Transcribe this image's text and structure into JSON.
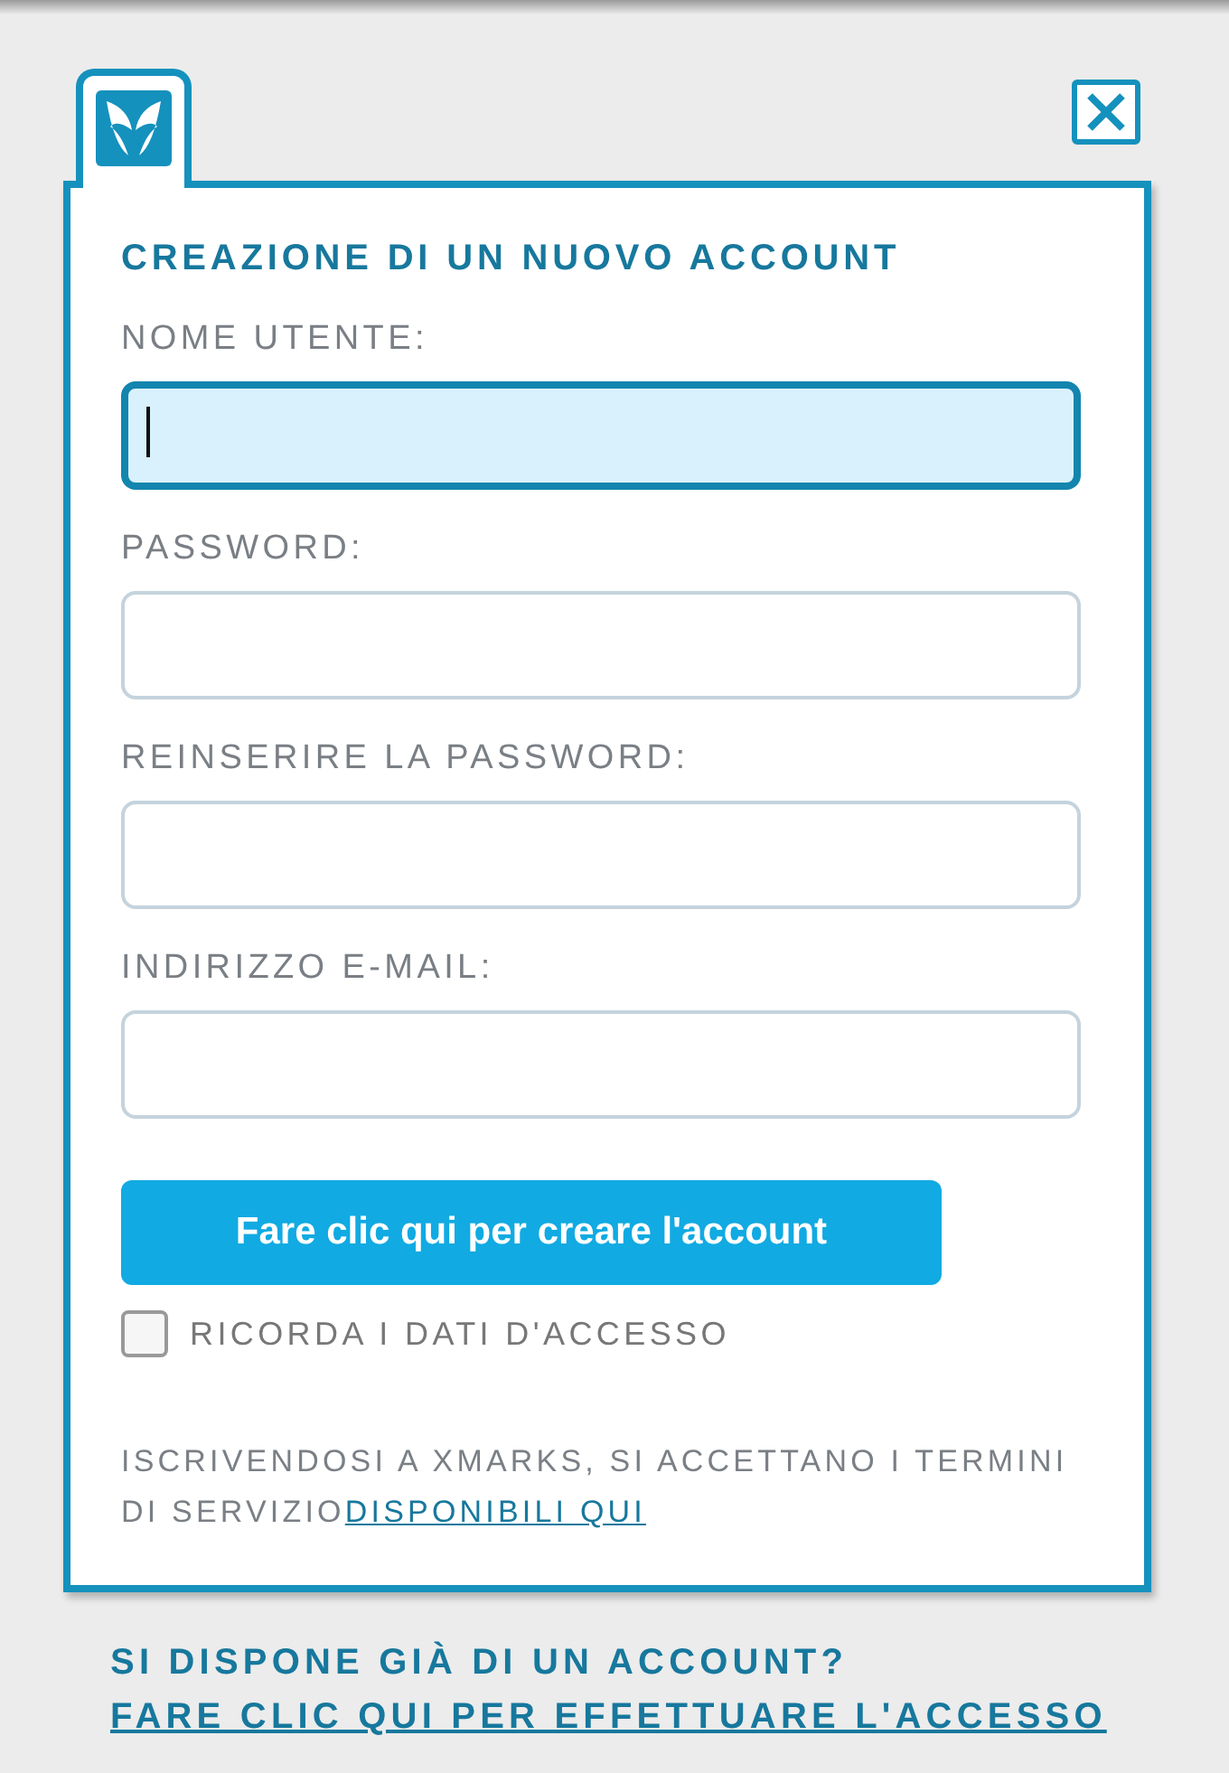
{
  "dialog": {
    "title": "CREAZIONE DI UN NUOVO ACCOUNT",
    "fields": [
      {
        "label": "NOME UTENTE:",
        "focused": true
      },
      {
        "label": "PASSWORD:",
        "focused": false
      },
      {
        "label": "REINSERIRE LA PASSWORD:",
        "focused": false
      },
      {
        "label": "INDIRIZZO E-MAIL:",
        "focused": false
      }
    ],
    "submit_button": "Fare clic qui per creare l'account",
    "remember": {
      "label": "RICORDA I DATI D'ACCESSO",
      "checked": false
    },
    "terms": {
      "text": "ISCRIVENDOSI A XMARKS, SI ACCETTANO I TERMINI DI SERVIZIO",
      "link": "DISPONIBILI QUI"
    }
  },
  "footer": {
    "text": "SI DISPONE GIÀ DI UN ACCOUNT?",
    "link": "FARE CLIC QUI PER EFFETTUARE L'ACCESSO"
  }
}
